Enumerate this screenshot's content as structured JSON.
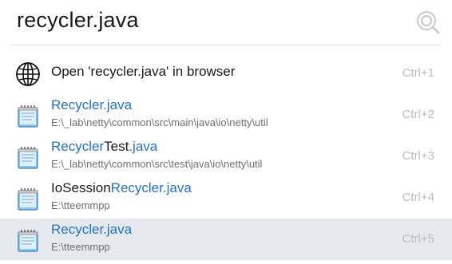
{
  "search": {
    "query": "recycler.java",
    "icon": "search-icon"
  },
  "results": [
    {
      "icon": "globe-icon",
      "title_parts": [
        {
          "text": "Open 'recycler.java' in browser",
          "highlight": false
        }
      ],
      "path": "",
      "shortcut": "Ctrl+1",
      "selected": false
    },
    {
      "icon": "notepad-icon",
      "title_parts": [
        {
          "text": "Recycler.java",
          "highlight": true
        }
      ],
      "path": "E:\\_lab\\netty\\common\\src\\main\\java\\io\\netty\\util",
      "shortcut": "Ctrl+2",
      "selected": false
    },
    {
      "icon": "notepad-icon",
      "title_parts": [
        {
          "text": "Recycler",
          "highlight": true
        },
        {
          "text": "Test",
          "highlight": false
        },
        {
          "text": ".java",
          "highlight": true
        }
      ],
      "path": "E:\\_lab\\netty\\common\\src\\test\\java\\io\\netty\\util",
      "shortcut": "Ctrl+3",
      "selected": false
    },
    {
      "icon": "notepad-icon",
      "title_parts": [
        {
          "text": "IoSession",
          "highlight": false
        },
        {
          "text": "Recycler.java",
          "highlight": true
        }
      ],
      "path": "E:\\tteemmpp",
      "shortcut": "Ctrl+4",
      "selected": false
    },
    {
      "icon": "notepad-icon",
      "title_parts": [
        {
          "text": "Recycler.java",
          "highlight": true
        }
      ],
      "path": "E:\\tteemmpp",
      "shortcut": "Ctrl+5",
      "selected": true
    }
  ],
  "colors": {
    "highlight": "#1f72c6",
    "selected_row": "#e6e9ee",
    "shortcut": "#bdbdbd",
    "path": "#6f6f6f"
  }
}
